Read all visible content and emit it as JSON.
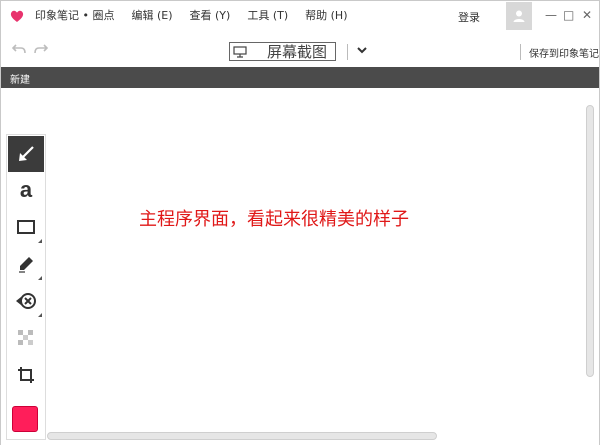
{
  "app": {
    "menu": [
      "印象笔记 • 圈点",
      "编辑 (E)",
      "查看 (Y)",
      "工具 (T)",
      "帮助 (H)"
    ],
    "login_label": "登录",
    "window_controls": [
      "—",
      "□",
      "✕"
    ]
  },
  "toolbar": {
    "document_title": "屏幕截图",
    "save_label": "保存到印象笔记"
  },
  "darkbar": {
    "new_label": "新建"
  },
  "canvas": {
    "annotation_text": "主程序界面，看起来很精美的样子",
    "annotation_color": "#e01818"
  },
  "tools": [
    {
      "name": "arrow-tool",
      "icon": "arrow-icon",
      "active": true
    },
    {
      "name": "text-tool",
      "icon": "text-a-icon",
      "glyph": "a"
    },
    {
      "name": "rectangle-tool",
      "icon": "rectangle-icon"
    },
    {
      "name": "marker-tool",
      "icon": "marker-icon"
    },
    {
      "name": "stamp-tool",
      "icon": "stamp-icon"
    },
    {
      "name": "pixelate-tool",
      "icon": "pixelate-icon"
    },
    {
      "name": "crop-tool",
      "icon": "crop-icon"
    }
  ],
  "current_color": "#ff1e5a",
  "brand_color": "#e8336d"
}
